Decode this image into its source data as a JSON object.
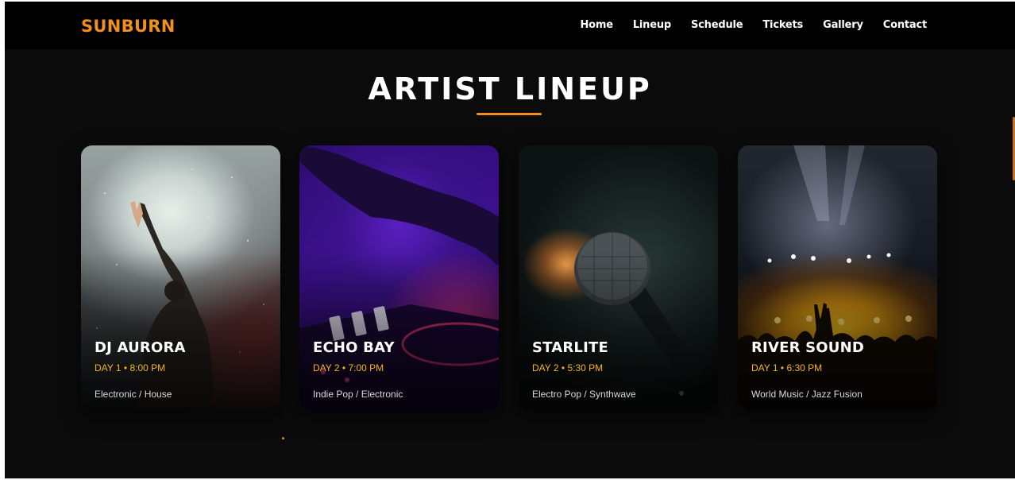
{
  "brand": "SUNBURN",
  "nav": [
    "Home",
    "Lineup",
    "Schedule",
    "Tickets",
    "Gallery",
    "Contact"
  ],
  "section": {
    "title": "ARTIST LINEUP"
  },
  "colors": {
    "accent": "#f2901c",
    "slot": "#f5b619",
    "background": "#0b0b0c"
  },
  "artists": [
    {
      "name": "DJ AURORA",
      "slot": "DAY 1 • 8:00 PM",
      "genre": "Electronic / House"
    },
    {
      "name": "ECHO BAY",
      "slot": "DAY 2 • 7:00 PM",
      "genre": "Indie Pop / Electronic"
    },
    {
      "name": "STARLITE",
      "slot": "DAY 2 • 5:30 PM",
      "genre": "Electro Pop / Synthwave"
    },
    {
      "name": "RIVER SOUND",
      "slot": "DAY 1 • 6:30 PM",
      "genre": "World Music / Jazz Fusion"
    }
  ]
}
